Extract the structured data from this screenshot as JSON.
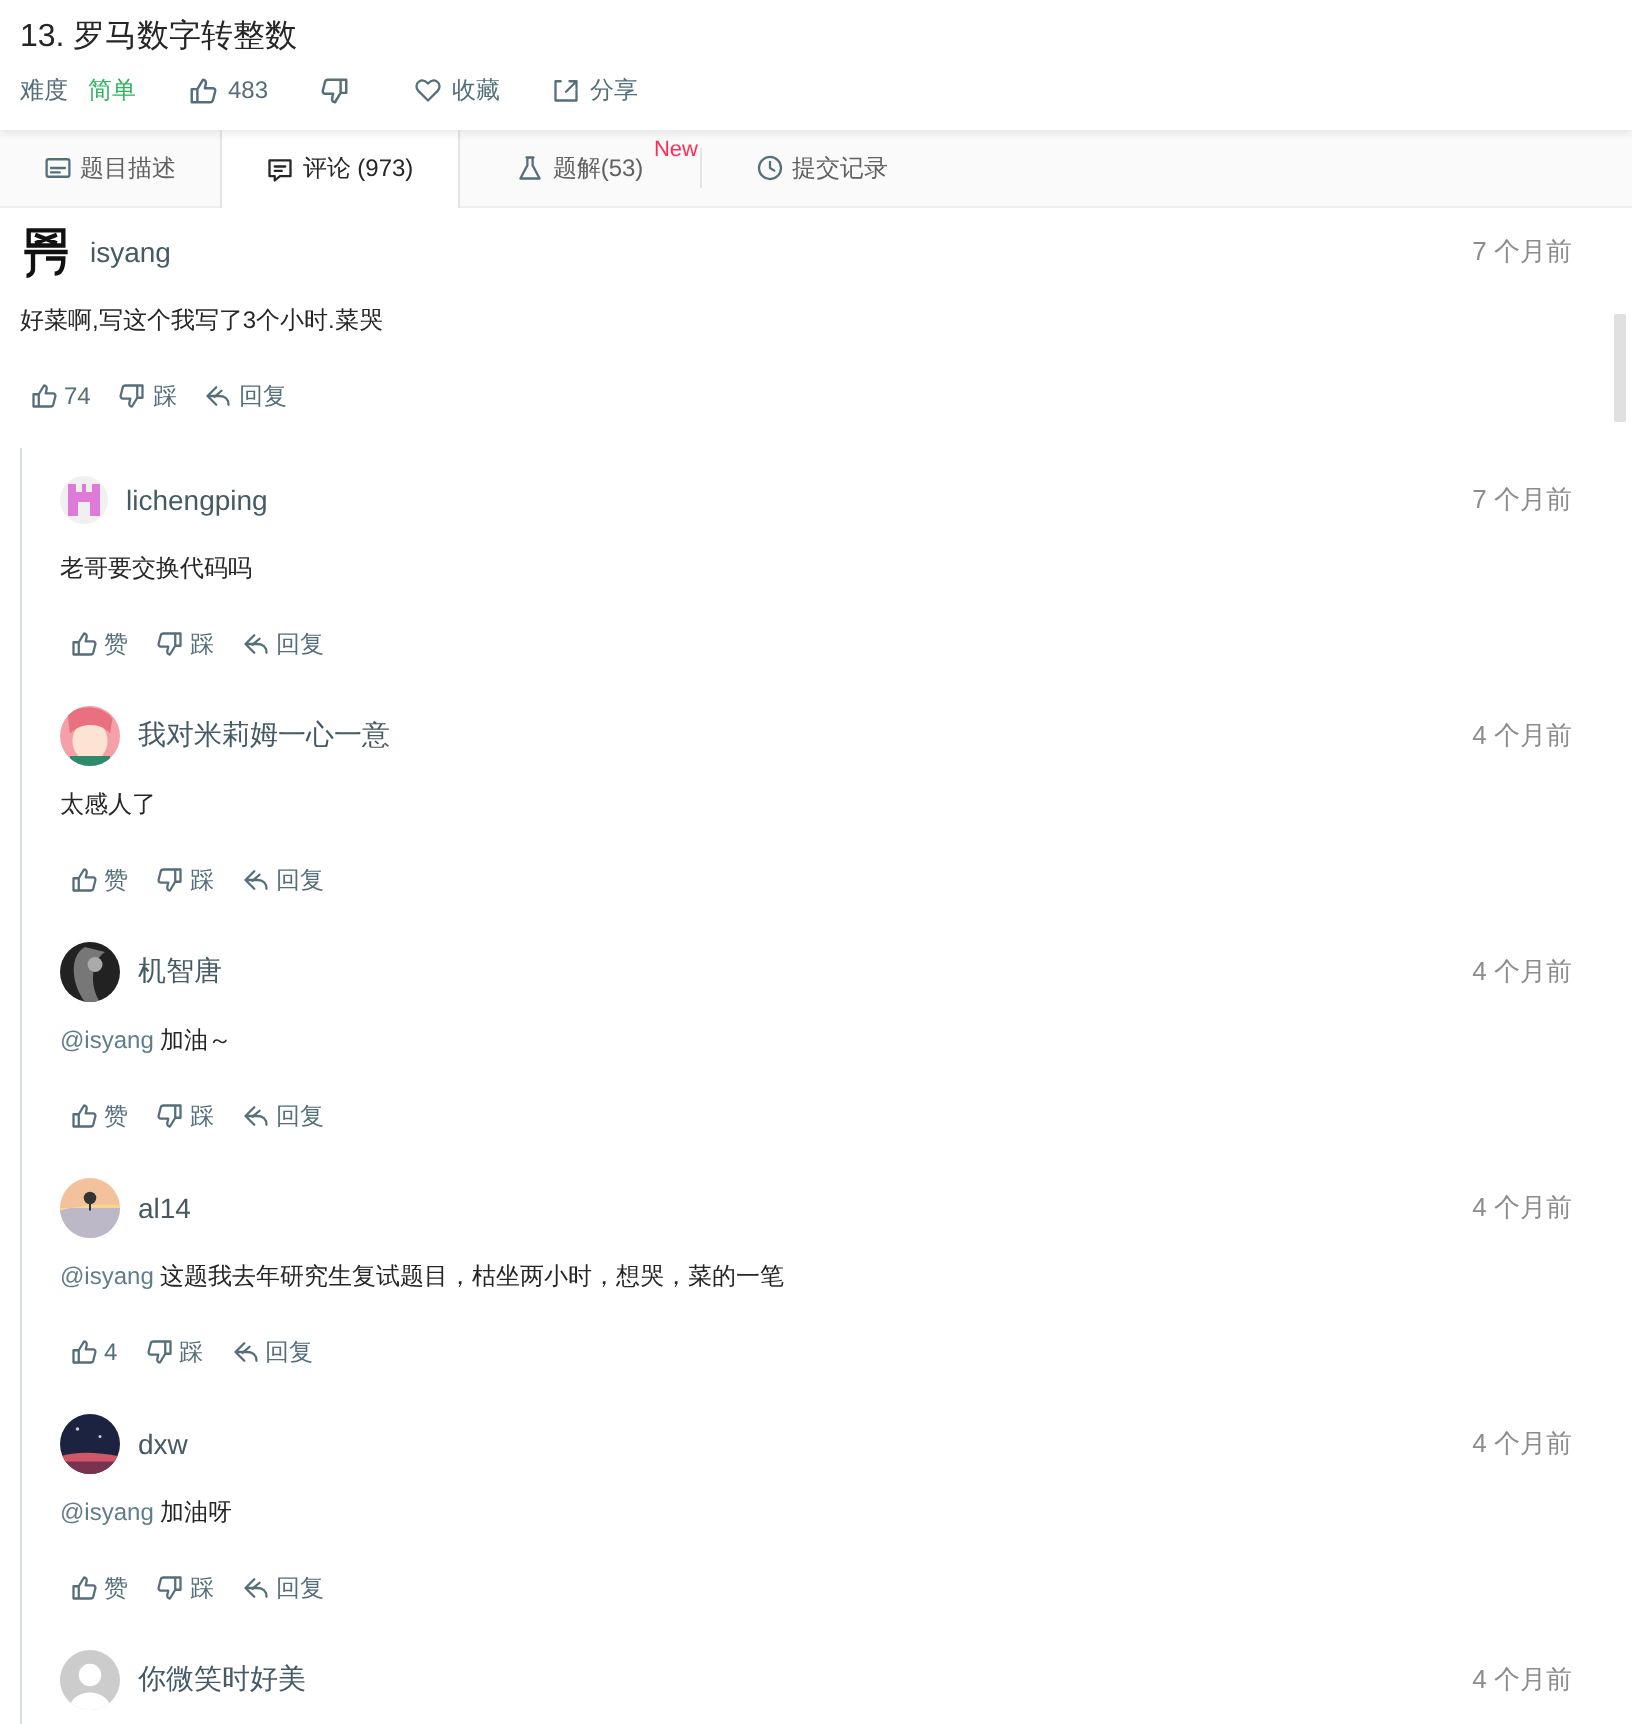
{
  "problem": {
    "title": "13. 罗马数字转整数",
    "difficulty_label": "难度",
    "difficulty": "简单",
    "likes": "483",
    "favorite": "收藏",
    "share": "分享"
  },
  "tabs": [
    {
      "label": "题目描述",
      "selected": false
    },
    {
      "label": "评论 (973)",
      "selected": true
    },
    {
      "label": "题解(53)",
      "selected": false,
      "badge": "New"
    },
    {
      "label": "提交记录",
      "selected": false
    }
  ],
  "comment": {
    "user": "isyang",
    "time": "7 个月前",
    "text": "好菜啊,写这个我写了3个小时.菜哭",
    "like": "74",
    "dislike": "踩",
    "reply": "回复"
  },
  "replies": [
    {
      "user": "lichengping",
      "time": "7 个月前",
      "text": "老哥要交换代码吗",
      "like": "赞",
      "dislike": "踩",
      "reply": "回复"
    },
    {
      "user": "我对米莉姆一心一意",
      "time": "4 个月前",
      "text": "太感人了",
      "like": "赞",
      "dislike": "踩",
      "reply": "回复"
    },
    {
      "user": "机智唐",
      "time": "4 个月前",
      "mention": "@isyang",
      "text": "加油～",
      "like": "赞",
      "dislike": "踩",
      "reply": "回复"
    },
    {
      "user": "al14",
      "time": "4 个月前",
      "mention": "@isyang",
      "text": "这题我去年研究生复试题目，枯坐两小时，想哭，菜的一笔",
      "like": "4",
      "dislike": "踩",
      "reply": "回复"
    },
    {
      "user": "dxw",
      "time": "4 个月前",
      "mention": "@isyang",
      "text": "加油呀",
      "like": "赞",
      "dislike": "踩",
      "reply": "回复"
    },
    {
      "user": "你微笑时好美",
      "time": "4 个月前"
    }
  ]
}
